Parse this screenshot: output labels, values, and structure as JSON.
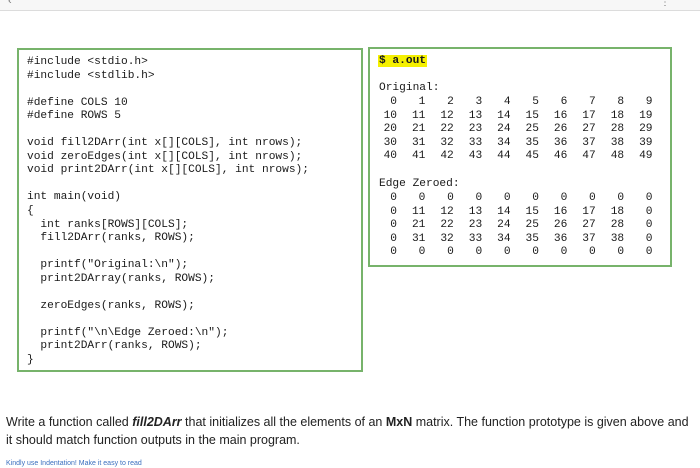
{
  "code": [
    "#include <stdio.h>",
    "#include <stdlib.h>",
    "",
    "#define COLS 10",
    "#define ROWS 5",
    "",
    "void fill2DArr(int x[][COLS], int nrows);",
    "void zeroEdges(int x[][COLS], int nrows);",
    "void print2DArr(int x[][COLS], int nrows);",
    "",
    "int main(void)",
    "{",
    "  int ranks[ROWS][COLS];",
    "  fill2DArr(ranks, ROWS);",
    "",
    "  printf(\"Original:\\n\");",
    "  print2DArray(ranks, ROWS);",
    "",
    "  zeroEdges(ranks, ROWS);",
    "",
    "  printf(\"\\n\\Edge Zeroed:\\n\");",
    "  print2DArr(ranks, ROWS);",
    "}"
  ],
  "output": {
    "command": "$ a.out",
    "original_title": "Original:",
    "original": [
      [
        "0",
        "1",
        "2",
        "3",
        "4",
        "5",
        "6",
        "7",
        "8",
        "9"
      ],
      [
        "10",
        "11",
        "12",
        "13",
        "14",
        "15",
        "16",
        "17",
        "18",
        "19"
      ],
      [
        "20",
        "21",
        "22",
        "23",
        "24",
        "25",
        "26",
        "27",
        "28",
        "29"
      ],
      [
        "30",
        "31",
        "32",
        "33",
        "34",
        "35",
        "36",
        "37",
        "38",
        "39"
      ],
      [
        "40",
        "41",
        "42",
        "43",
        "44",
        "45",
        "46",
        "47",
        "48",
        "49"
      ]
    ],
    "zeroed_title": "Edge Zeroed:",
    "zeroed": [
      [
        "0",
        "0",
        "0",
        "0",
        "0",
        "0",
        "0",
        "0",
        "0",
        "0"
      ],
      [
        "0",
        "11",
        "12",
        "13",
        "14",
        "15",
        "16",
        "17",
        "18",
        "0"
      ],
      [
        "0",
        "21",
        "22",
        "23",
        "24",
        "25",
        "26",
        "27",
        "28",
        "0"
      ],
      [
        "0",
        "31",
        "32",
        "33",
        "34",
        "35",
        "36",
        "37",
        "38",
        "0"
      ],
      [
        "0",
        "0",
        "0",
        "0",
        "0",
        "0",
        "0",
        "0",
        "0",
        "0"
      ]
    ]
  },
  "question": {
    "p1": "Write a function called ",
    "fn": "fill2DArr",
    "p2": " that initializes all the elements of an ",
    "dim": "MxN",
    "p3": " matrix. The function prototype is given above and it should match function outputs in the main program."
  },
  "footnote": "Kindly use Indentation! Make it easy to read"
}
